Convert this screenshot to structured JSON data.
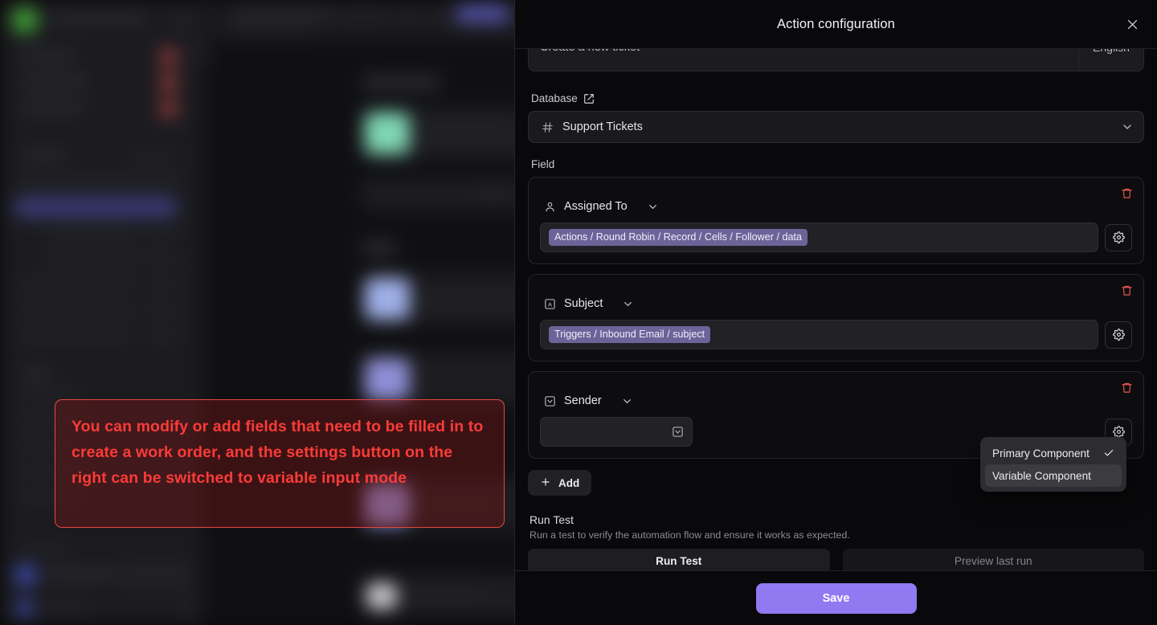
{
  "background_app": {
    "description": "blurred workspace application behind the modal"
  },
  "panel": {
    "title": "Action configuration",
    "close_icon": "close-icon",
    "top_row": {
      "action_name": "Create a new ticket",
      "language": "English"
    },
    "database": {
      "label": "Database",
      "external_link_icon": "external-link-icon",
      "selected": "Support Tickets",
      "type_icon": "hash-icon",
      "chevron_icon": "chevron-down-icon"
    },
    "field_section": {
      "label": "Field",
      "cards": [
        {
          "name": "Assigned To",
          "type_icon": "person-icon",
          "chevron_icon": "chevron-down-icon",
          "delete_icon": "trash-icon",
          "settings_icon": "gear-icon",
          "value_chip": "Actions / Round Robin / Record / Cells / Follower / data",
          "empty": false
        },
        {
          "name": "Subject",
          "type_icon": "text-field-icon",
          "chevron_icon": "chevron-down-icon",
          "delete_icon": "trash-icon",
          "settings_icon": "gear-icon",
          "value_chip": "Triggers / Inbound Email / subject",
          "empty": false
        },
        {
          "name": "Sender",
          "type_icon": "select-field-icon",
          "chevron_icon": "chevron-down-icon",
          "delete_icon": "trash-icon",
          "settings_icon": "gear-icon",
          "value_chip": "",
          "empty": true,
          "input_icon": "select-field-icon"
        }
      ],
      "add_label": "Add",
      "add_icon": "plus-icon"
    },
    "run_test": {
      "title": "Run Test",
      "description": "Run a test to verify the automation flow and ensure it works as expected.",
      "primary_button": "Run Test",
      "secondary_button": "Preview last run"
    },
    "footer": {
      "save_label": "Save"
    }
  },
  "component_menu": {
    "items": [
      {
        "label": "Primary Component",
        "selected": true,
        "check_icon": "check-icon"
      },
      {
        "label": "Variable Component",
        "selected": false,
        "hovered": true
      }
    ]
  },
  "annotation": {
    "text": "You can modify or add fields that need to be filled in to create a work order, and the settings button on the right can be switched to variable input mode",
    "border_color": "#e3493f",
    "text_color": "#fb3b38"
  },
  "colors": {
    "accent": "#9179f2",
    "chip": "#6c6499",
    "danger": "#e4564d",
    "panel_bg": "#09090b"
  }
}
